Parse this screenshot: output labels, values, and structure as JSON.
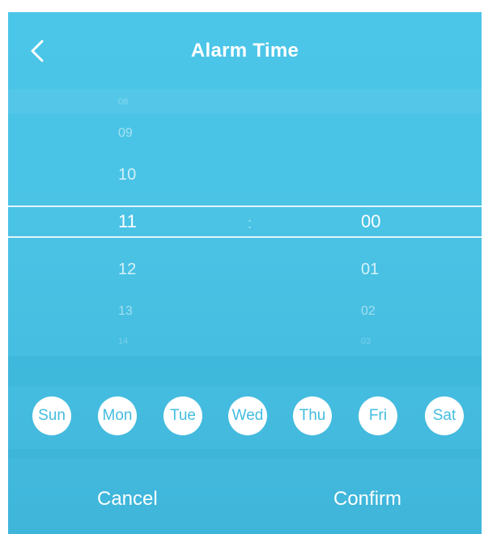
{
  "header": {
    "title": "Alarm Time",
    "back_icon": "chevron-left-icon"
  },
  "picker": {
    "hours": [
      "08",
      "09",
      "10",
      "11",
      "12",
      "13",
      "14"
    ],
    "selected_hour": "11",
    "separator": ":",
    "minutes": [
      "00",
      "01",
      "02",
      "03"
    ],
    "selected_minute": "00"
  },
  "days": [
    "Sun",
    "Mon",
    "Tue",
    "Wed",
    "Thu",
    "Fri",
    "Sat"
  ],
  "footer": {
    "cancel_label": "Cancel",
    "confirm_label": "Confirm"
  },
  "colors": {
    "background": "#4ac3e5",
    "day_text": "#43bde0",
    "text": "#ffffff"
  }
}
